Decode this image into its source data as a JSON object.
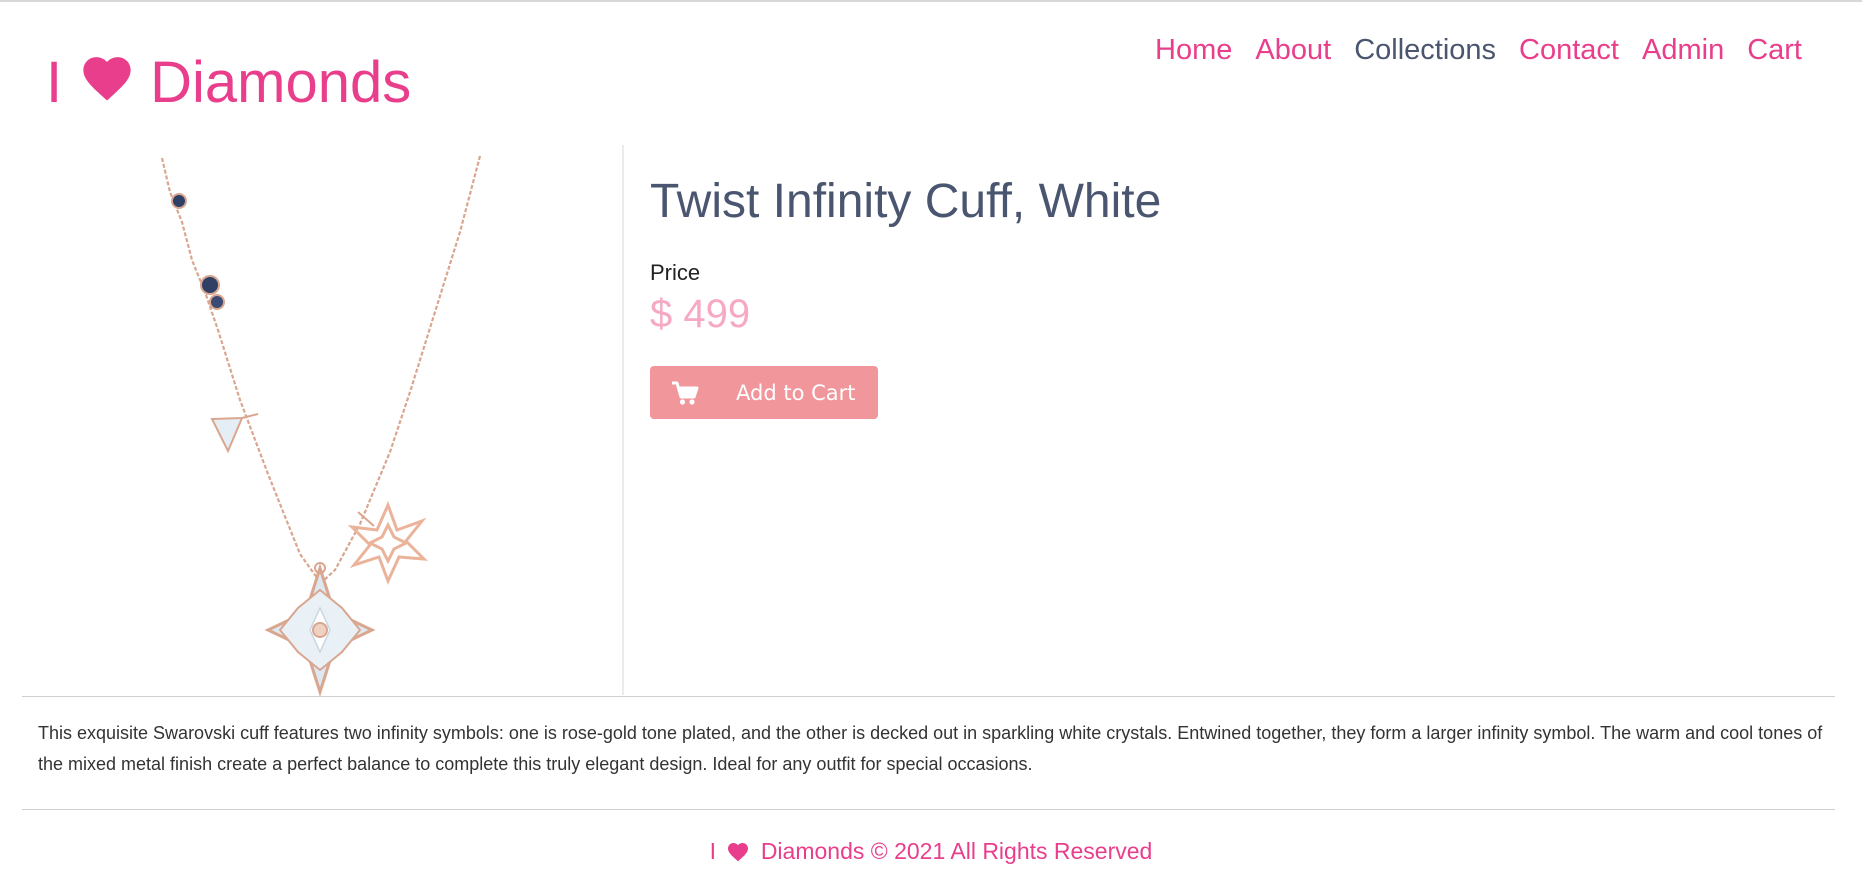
{
  "brand": {
    "prefix": "I",
    "heart_icon": "heart-icon",
    "name": "Diamonds",
    "color": "#e83e8c"
  },
  "nav": {
    "items": [
      {
        "label": "Home"
      },
      {
        "label": "About"
      },
      {
        "label": "Collections",
        "active": true
      },
      {
        "label": "Contact"
      },
      {
        "label": "Admin"
      },
      {
        "label": "Cart"
      }
    ],
    "active_color": "#4a5670"
  },
  "product": {
    "image_icon": "necklace-image",
    "title": "Twist Infinity Cuff, White",
    "price_label": "Price",
    "price_value": "$ 499",
    "add_to_cart_label": "Add to Cart",
    "add_to_cart_icon": "cart-icon",
    "button_color": "#f1969b",
    "price_color": "#f7a8c4"
  },
  "description": "This exquisite Swarovski cuff features two infinity symbols: one is rose-gold tone plated, and the other is decked out in sparkling white crystals. Entwined together, they form a larger infinity symbol. The warm and cool tones of the mixed metal finish create a perfect balance to complete this truly elegant design. Ideal for any outfit for special occasions.",
  "footer": {
    "prefix": "I",
    "heart_icon": "heart-icon",
    "text": "Diamonds © 2021 All Rights Reserved"
  }
}
